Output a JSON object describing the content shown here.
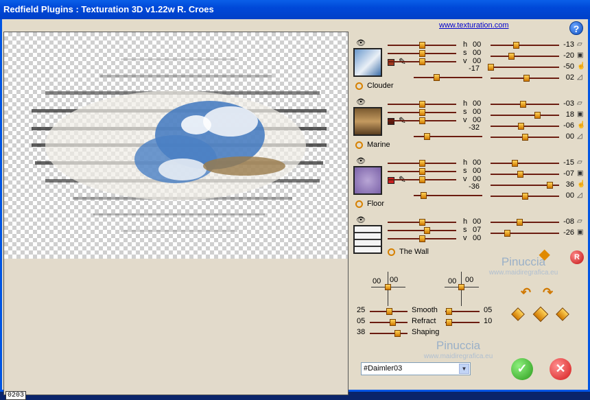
{
  "window": {
    "title": "Redfield Plugins : Texturation 3D v1.22w   R. Croes"
  },
  "header": {
    "link_text": "www.texturation.com",
    "help_label": "?"
  },
  "preview": {
    "frame_counter": "0203"
  },
  "layers": [
    {
      "name": "Clouder",
      "swatch_color": "#a03a20",
      "hsv": [
        {
          "label": "h",
          "value": "00",
          "pos": 0.5
        },
        {
          "label": "s",
          "value": "00",
          "pos": 0.5
        },
        {
          "label": "v",
          "value": "00",
          "pos": 0.5
        }
      ],
      "extra": {
        "value": "-17",
        "pos": 0.33
      },
      "right": [
        {
          "value": "-13",
          "pos": 0.37
        },
        {
          "value": "-20",
          "pos": 0.3
        },
        {
          "value": "-50",
          "pos": 0.0
        },
        {
          "value": "02",
          "pos": 0.52
        }
      ]
    },
    {
      "name": "Marine",
      "swatch_color": "#5a1a10",
      "hsv": [
        {
          "label": "h",
          "value": "00",
          "pos": 0.5
        },
        {
          "label": "s",
          "value": "00",
          "pos": 0.5
        },
        {
          "label": "v",
          "value": "00",
          "pos": 0.5
        }
      ],
      "extra": {
        "value": "-32",
        "pos": 0.19
      },
      "right": [
        {
          "value": "-03",
          "pos": 0.47
        },
        {
          "value": "18",
          "pos": 0.68
        },
        {
          "value": "-06",
          "pos": 0.44
        },
        {
          "value": "00",
          "pos": 0.5
        }
      ]
    },
    {
      "name": "Floor",
      "swatch_color": "#c82020",
      "hsv": [
        {
          "label": "h",
          "value": "00",
          "pos": 0.5
        },
        {
          "label": "s",
          "value": "00",
          "pos": 0.5
        },
        {
          "label": "v",
          "value": "00",
          "pos": 0.5
        }
      ],
      "extra": {
        "value": "-36",
        "pos": 0.14
      },
      "right": [
        {
          "value": "-15",
          "pos": 0.35
        },
        {
          "value": "-07",
          "pos": 0.43
        },
        {
          "value": "36",
          "pos": 0.86
        },
        {
          "value": "00",
          "pos": 0.5
        }
      ]
    },
    {
      "name": "The Wall",
      "hsv": [
        {
          "label": "h",
          "value": "00",
          "pos": 0.5
        },
        {
          "label": "s",
          "value": "07",
          "pos": 0.57
        },
        {
          "label": "v",
          "value": "00",
          "pos": 0.5
        }
      ],
      "right": [
        {
          "value": "-08",
          "pos": 0.42
        },
        {
          "value": "-26",
          "pos": 0.24
        }
      ]
    }
  ],
  "light": {
    "left": {
      "x": "00",
      "y": "00"
    },
    "right": {
      "x": "00",
      "y": "00"
    }
  },
  "params": [
    {
      "left_value": "25",
      "label": "Smooth",
      "right_value": "05",
      "left_pos": 0.5,
      "right_pos": 0.1
    },
    {
      "left_value": "05",
      "label": "Refract",
      "right_value": "10",
      "left_pos": 0.6,
      "right_pos": 0.1
    },
    {
      "left_value": "38",
      "label": "Shaping",
      "left_pos": 0.72
    }
  ],
  "watermark": {
    "name": "Pinuccia",
    "site": "www.maidiregrafica.eu"
  },
  "preset": {
    "selected": "#Daimler03"
  },
  "buttons": {
    "ok": "✓",
    "cancel": "✕",
    "reset": "R"
  }
}
